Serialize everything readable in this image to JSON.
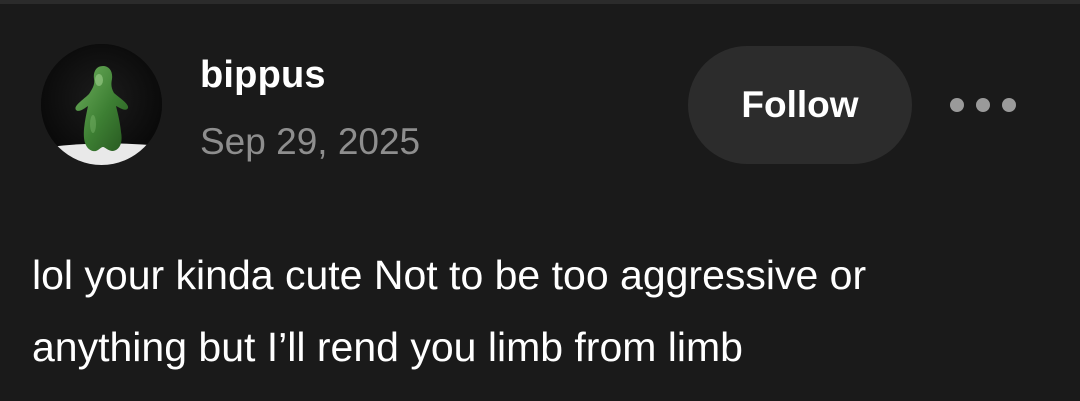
{
  "post": {
    "username": "bippus",
    "date": "Sep 29, 2025",
    "follow_label": "Follow",
    "more_icon": "more-horizontal-icon",
    "avatar_icon": "green-figure-avatar",
    "body_lines": [
      "lol your kinda cute Not to be too aggressive or",
      "anything but I’ll rend you limb from limb"
    ]
  },
  "colors": {
    "background": "#1a1a1a",
    "username": "#ffffff",
    "date": "#8e8e8e",
    "follow_button_bg": "#2c2c2c",
    "avatar_figure": "#3f8a3a"
  }
}
